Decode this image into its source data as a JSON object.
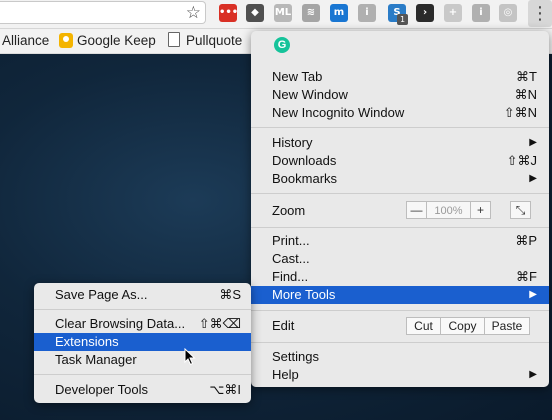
{
  "toolbar": {
    "extensions": [
      {
        "name": "red-dots-extension-icon",
        "text": "•••",
        "color": "#d93025"
      },
      {
        "name": "pocket-icon",
        "text": "◆",
        "color": "#505050"
      },
      {
        "name": "ml-extension-icon",
        "text": "ML",
        "color": "#b8b8b8"
      },
      {
        "name": "grey-extension-icon",
        "text": "≋",
        "color": "#a5a5a5"
      },
      {
        "name": "blue-m-extension-icon",
        "text": "m",
        "color": "#1976d2"
      },
      {
        "name": "info-extension-icon",
        "text": "i",
        "color": "#b0b0b0"
      },
      {
        "name": "s-extension-icon",
        "text": "S",
        "color": "#2a7cc7"
      },
      {
        "name": "dark-arrow-extension-icon",
        "text": "›",
        "color": "#2b2b2b"
      },
      {
        "name": "plus-extension-icon",
        "text": "+",
        "color": "#c9c9c9"
      },
      {
        "name": "info-extension-icon-2",
        "text": "i",
        "color": "#b0b0b0"
      },
      {
        "name": "faded-extension-icon",
        "text": "◎",
        "color": "#c4c4c4"
      }
    ],
    "s_badge": "1"
  },
  "bookmarks": {
    "items": [
      "Alliance",
      "Google Keep",
      "Pullquote"
    ]
  },
  "main_menu": {
    "new_tab": {
      "label": "New Tab",
      "shortcut": "⌘T"
    },
    "new_window": {
      "label": "New Window",
      "shortcut": "⌘N"
    },
    "new_incognito": {
      "label": "New Incognito Window",
      "shortcut": "⇧⌘N"
    },
    "history": {
      "label": "History"
    },
    "downloads": {
      "label": "Downloads",
      "shortcut": "⇧⌘J"
    },
    "bookmarks": {
      "label": "Bookmarks"
    },
    "zoom": {
      "label": "Zoom",
      "minus": "—",
      "value": "100%",
      "plus": "+",
      "fullscreen": "⤡"
    },
    "print": {
      "label": "Print...",
      "shortcut": "⌘P"
    },
    "cast": {
      "label": "Cast..."
    },
    "find": {
      "label": "Find...",
      "shortcut": "⌘F"
    },
    "more_tools": {
      "label": "More Tools"
    },
    "edit": {
      "label": "Edit",
      "cut": "Cut",
      "copy": "Copy",
      "paste": "Paste"
    },
    "settings": {
      "label": "Settings"
    },
    "help": {
      "label": "Help"
    },
    "arrow": "▶"
  },
  "sub_menu": {
    "save_page": {
      "label": "Save Page As...",
      "shortcut": "⌘S"
    },
    "clear_data": {
      "label": "Clear Browsing Data...",
      "shortcut": "⇧⌘⌫"
    },
    "extensions": {
      "label": "Extensions"
    },
    "task_manager": {
      "label": "Task Manager"
    },
    "dev_tools": {
      "label": "Developer Tools",
      "shortcut": "⌥⌘I"
    }
  },
  "colors": {
    "highlight": "#1a5fcf",
    "menu_bg": "#e9e9e9"
  }
}
